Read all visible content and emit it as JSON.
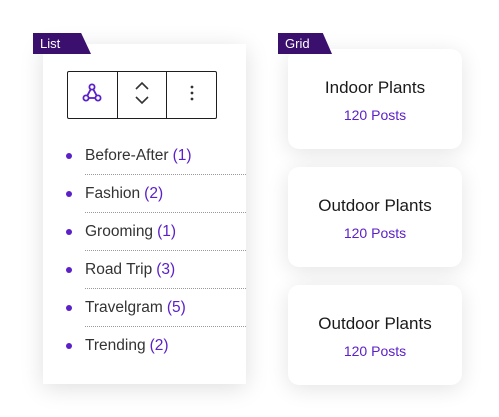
{
  "list_tag": "List",
  "grid_tag": "Grid",
  "toolbar": {
    "buttons": [
      {
        "icon": "block-type-icon"
      },
      {
        "icon": "move-up-down-icon"
      },
      {
        "icon": "more-options-icon"
      }
    ]
  },
  "list_items": [
    {
      "label": "Before-After",
      "count": "(1)"
    },
    {
      "label": "Fashion",
      "count": "(2)"
    },
    {
      "label": "Grooming",
      "count": "(1)"
    },
    {
      "label": "Road Trip",
      "count": "(3)"
    },
    {
      "label": "Travelgram",
      "count": "(5)"
    },
    {
      "label": "Trending",
      "count": "(2)"
    }
  ],
  "grid_cards": [
    {
      "title": "Indoor Plants",
      "count": "120 Posts"
    },
    {
      "title": "Outdoor Plants",
      "count": "120 Posts"
    },
    {
      "title": "Outdoor Plants",
      "count": "120 Posts"
    }
  ],
  "colors": {
    "tag_bg": "#3a0f6e",
    "accent": "#5b20c8",
    "text": "#333333"
  }
}
